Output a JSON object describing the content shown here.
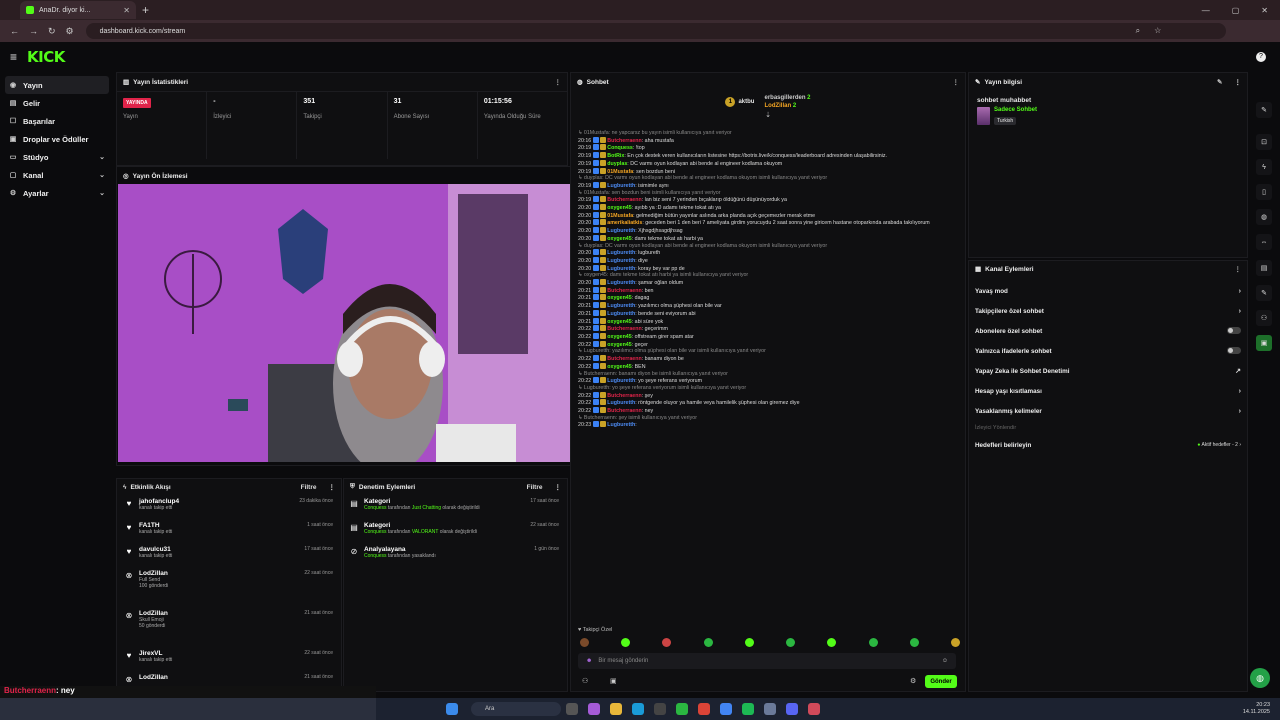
{
  "browser": {
    "tab_title": "AnaDr. diyor ki...",
    "url": "dashboard.kick.com/stream"
  },
  "brand": {
    "logo_text": "KICK",
    "accent": "#53fc18"
  },
  "sidebar": {
    "items": [
      {
        "label": "Yayın",
        "icon": "broadcast-icon"
      },
      {
        "label": "Gelir",
        "icon": "revenue-icon"
      },
      {
        "label": "Başarılar",
        "icon": "achievement-icon"
      },
      {
        "label": "Droplar ve Ödüller",
        "icon": "gift-icon"
      },
      {
        "label": "Stüdyo",
        "icon": "studio-icon"
      },
      {
        "label": "Kanal",
        "icon": "channel-icon"
      },
      {
        "label": "Ayarlar",
        "icon": "gear-icon"
      }
    ]
  },
  "stats": {
    "title": "Yayın İstatistikleri",
    "live_badge": "YAYINDA",
    "items": [
      {
        "value": "",
        "label": "Yayın"
      },
      {
        "value": "-",
        "label": "İzleyici"
      },
      {
        "value": "351",
        "label": "Takipçi"
      },
      {
        "value": "31",
        "label": "Abone Sayısı"
      },
      {
        "value": "01:15:56",
        "label": "Yayında Olduğu Süre"
      }
    ]
  },
  "preview": {
    "title": "Yayın Ön İzlemesi"
  },
  "activity": {
    "title": "Etkinlik Akışı",
    "filter": "Filtre",
    "items": [
      {
        "name": "jahofanclup4",
        "sub": "kanalı takip etti",
        "extra": "",
        "time": "23 dakika önce"
      },
      {
        "name": "FA1TH",
        "sub": "kanalı takip etti",
        "extra": "",
        "time": "1 saat önce"
      },
      {
        "name": "davulcu31",
        "sub": "kanalı takip etti",
        "extra": "",
        "time": "17 saat önce"
      },
      {
        "name": "LodZillan",
        "sub": "Full Send",
        "extra": "100 gönderdi",
        "time": "22 saat önce"
      },
      {
        "name": "LodZillan",
        "sub": "Skull Emoji",
        "extra": "50 gönderdi",
        "time": "21 saat önce"
      },
      {
        "name": "JirexVL",
        "sub": "kanalı takip etti",
        "extra": "",
        "time": "22 saat önce"
      },
      {
        "name": "LodZillan",
        "sub": "",
        "extra": "",
        "time": "21 saat önce"
      }
    ]
  },
  "moderation": {
    "title": "Denetim Eylemleri",
    "filter": "Filtre",
    "items": [
      {
        "title": "Kategori",
        "user": "Conquess",
        "mid": "tarafından",
        "target": "Just Chatting",
        "tail": "olarak değiştirildi",
        "time": "17 saat önce"
      },
      {
        "title": "Kategori",
        "user": "Conquess",
        "mid": "tarafından",
        "target": "VALORANT",
        "tail": "olarak değiştirildi",
        "time": "22 saat önce"
      },
      {
        "title": "Analyalayana",
        "user": "Conquess",
        "mid": "tarafından yasaklandı",
        "target": "",
        "tail": "",
        "time": "1 gün önce"
      }
    ]
  },
  "chat": {
    "title": "Sohbet",
    "top": [
      {
        "name": "aktbu",
        "count": "1"
      },
      {
        "name": "erbasgillerden",
        "count": "2"
      },
      {
        "name": "LodZillan",
        "count": "2"
      }
    ],
    "lines": [
      {
        "reply": "01Mustafa: ne yapcarsz bu yayın isimli kullanıcıya yanıt veriyor"
      },
      {
        "t": "20:16",
        "u": "Butcherraenn",
        "c": "#e0244a",
        "m": "aha mustafa"
      },
      {
        "t": "20:19",
        "u": "Conquess",
        "c": "#53fc18",
        "m": "!top"
      },
      {
        "t": "20:19",
        "u": "BotRix",
        "c": "#53fc18",
        "m": "En çok destek veren kullanıcıların listesine https://botrix.live/k/conquess/leaderboard adresinden ulaşabilirsiniz."
      },
      {
        "t": "20:19",
        "u": "duyplas",
        "c": "#53fc18",
        "m": "DC varmı oyun kodlayan abi bende al engineer kodlama okuyom"
      },
      {
        "t": "20:19",
        "u": "01Mustafa",
        "c": "#f5a623",
        "m": "sen bozdun beni"
      },
      {
        "reply": "duyplas: DC varmı oyun kodlayan abi bende al engineer kodlama okuyom isimli kullanıcıya yanıt veriyor"
      },
      {
        "t": "20:19",
        "u": "Lugburetth",
        "c": "#4d8cf5",
        "m": "isimimle aynı"
      },
      {
        "reply": "01Mustafa: sen bozdun beni isimli kullanıcıya yanıt veriyor"
      },
      {
        "t": "20:19",
        "u": "Butcherraenn",
        "c": "#e0244a",
        "m": "lan biz seni 7 yerinden bıçaklarıp öldüğünü düşünüyorduk ya"
      },
      {
        "t": "20:20",
        "u": "oxygen45",
        "c": "#53fc18",
        "m": "ayıbb ya :D adamı tekme tokat atı ya"
      },
      {
        "t": "20:20",
        "u": "01Mustafa",
        "c": "#f5a623",
        "m": "gelmediğim bütün yayınlar aslında arka planda açık geçemezler merak etme"
      },
      {
        "t": "20:20",
        "u": "amerikaliatkis",
        "c": "#f5a623",
        "m": "geceden beri 1 den beri 7 ameliyata girdim yorucuydu 2 saat sonra yine giricem hastane otoparkında arabada takılıyorum"
      },
      {
        "t": "20:20",
        "u": "Lugburetth",
        "c": "#4d8cf5",
        "m": "Xjhsgdjhsagdjhsag"
      },
      {
        "t": "20:20",
        "u": "oxygen45",
        "c": "#53fc18",
        "m": "damı tekme tokat atı harbi ya"
      },
      {
        "reply": "duyplas: DC varmı oyun kodlayan abi bende al engineer kodlama okuyom isimli kullanıcıya yanıt veriyor"
      },
      {
        "t": "20:20",
        "u": "Lugburetth",
        "c": "#4d8cf5",
        "m": "lugbureth"
      },
      {
        "t": "20:20",
        "u": "Lugburetth",
        "c": "#4d8cf5",
        "m": "diye"
      },
      {
        "t": "20:20",
        "u": "Lugburetth",
        "c": "#4d8cf5",
        "m": "koray bey var pp de"
      },
      {
        "reply": "oxygen45: damı tekme tokat atı harbi ya isimli kullanıcıya yanıt veriyor"
      },
      {
        "t": "20:20",
        "u": "Lugburetth",
        "c": "#4d8cf5",
        "m": "şamar oğlan oldum"
      },
      {
        "t": "20:21",
        "u": "Butcherraenn",
        "c": "#e0244a",
        "m": "ben"
      },
      {
        "t": "20:21",
        "u": "oxygen45",
        "c": "#53fc18",
        "m": "dagag"
      },
      {
        "t": "20:21",
        "u": "Lugburetth",
        "c": "#4d8cf5",
        "m": "yazılımcı olma şüphesi olan bile var"
      },
      {
        "t": "20:21",
        "u": "Lugburetth",
        "c": "#4d8cf5",
        "m": "bende seni eviyorum abi"
      },
      {
        "t": "20:21",
        "u": "oxygen45",
        "c": "#53fc18",
        "m": "abi süre yok"
      },
      {
        "t": "20:22",
        "u": "Butcherraenn",
        "c": "#e0244a",
        "m": "geçerimm"
      },
      {
        "t": "20:22",
        "u": "oxygen45",
        "c": "#53fc18",
        "m": "offstream girer spam atar"
      },
      {
        "t": "20:22",
        "u": "oxygen45",
        "c": "#53fc18",
        "m": "geçer"
      },
      {
        "reply": "Lugburetth: yazılımcı olma şüphesi olan bile var isimli kullanıcıya yanıt veriyor"
      },
      {
        "t": "20:22",
        "u": "Butcherraenn",
        "c": "#e0244a",
        "m": "banamı diyon be"
      },
      {
        "t": "20:22",
        "u": "oxygen45",
        "c": "#53fc18",
        "m": "BEN"
      },
      {
        "reply": "Butcherraenn: banamı diyon be isimli kullanıcıya yanıt veriyor"
      },
      {
        "t": "20:22",
        "u": "Lugburetth",
        "c": "#4d8cf5",
        "m": "yo şeye referans veriyorum"
      },
      {
        "reply": "Lugburetth: yo şeye referans veriyorum isimli kullanıcıya yanıt veriyor"
      },
      {
        "t": "20:22",
        "u": "Butcherraenn",
        "c": "#e0244a",
        "m": "şey"
      },
      {
        "t": "20:22",
        "u": "Lugburetth",
        "c": "#4d8cf5",
        "m": "röntgende oluyor ya hamile veya hamilelik şüphesi olan giremez diye"
      },
      {
        "t": "20:22",
        "u": "Butcherraenn",
        "c": "#e0244a",
        "m": "ney"
      },
      {
        "reply": "Butcherraenn: şey isimli kullanıcıya yanıt veriyor"
      },
      {
        "t": "20:23",
        "u": "Lugburetth",
        "c": "#4d8cf5",
        "m": ""
      }
    ],
    "followers_only": "Takipçi Özel",
    "input_placeholder": "Bir mesaj gönderin",
    "send_label": "Gönder"
  },
  "stream_info": {
    "title": "Yayın bilgisi",
    "stream_title": "sohbet muhabbet",
    "category": "Sadece Sohbet",
    "language": "Turkish"
  },
  "channel_actions": {
    "title": "Kanal Eylemleri",
    "items": [
      {
        "label": "Yavaş mod",
        "kind": "chevron"
      },
      {
        "label": "Takipçilere özel sohbet",
        "kind": "chevron"
      },
      {
        "label": "Abonelere özel sohbet",
        "kind": "toggle"
      },
      {
        "label": "Yalnızca ifadelerle sohbet",
        "kind": "toggle"
      },
      {
        "label": "Yapay Zeka ile Sohbet Denetimi",
        "kind": "external"
      },
      {
        "label": "Hesap yaşı kısıtlaması",
        "kind": "chevron"
      },
      {
        "label": "Yasaklanmış kelimeler",
        "kind": "chevron"
      }
    ],
    "section_label": "İzleyici Yönlendir",
    "goals_label": "Hedefleri belirleyin",
    "goals_status": "Aktif hedefler - 2"
  },
  "overlay_chat": [
    {
      "u": "Butcherraenn",
      "m": ": ney"
    },
    {
      "u": "Lugburetth",
      "m": ""
    }
  ],
  "taskbar": {
    "search": "Ara",
    "time": "20:23",
    "date": "14.11.2025"
  }
}
